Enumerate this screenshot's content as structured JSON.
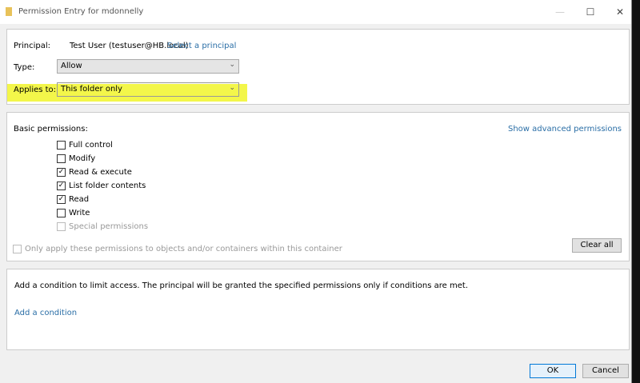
{
  "window": {
    "title": "Permission Entry for mdonnelly",
    "minimize": "—",
    "maximize": "☐",
    "close": "✕"
  },
  "principal": {
    "label": "Principal:",
    "value": "Test User (testuser@HB.local)",
    "link": "Select a principal"
  },
  "type": {
    "label": "Type:",
    "value": "Allow"
  },
  "applies_to": {
    "label": "Applies to:",
    "value": "This folder only",
    "highlight_color": "#f1f52a"
  },
  "permissions": {
    "label": "Basic permissions:",
    "advanced_link": "Show advanced permissions",
    "items": [
      {
        "label": "Full control",
        "checked": false
      },
      {
        "label": "Modify",
        "checked": false
      },
      {
        "label": "Read & execute",
        "checked": true
      },
      {
        "label": "List folder contents",
        "checked": true
      },
      {
        "label": "Read",
        "checked": true
      },
      {
        "label": "Write",
        "checked": false
      },
      {
        "label": "Special permissions",
        "checked": false,
        "disabled": true
      }
    ],
    "only_apply": "Only apply these permissions to objects and/or containers within this container",
    "clear_all": "Clear all"
  },
  "condition": {
    "text": "Add a condition to limit access. The principal will be granted the specified permissions only if conditions are met.",
    "link": "Add a condition"
  },
  "footer": {
    "ok": "OK",
    "cancel": "Cancel"
  }
}
